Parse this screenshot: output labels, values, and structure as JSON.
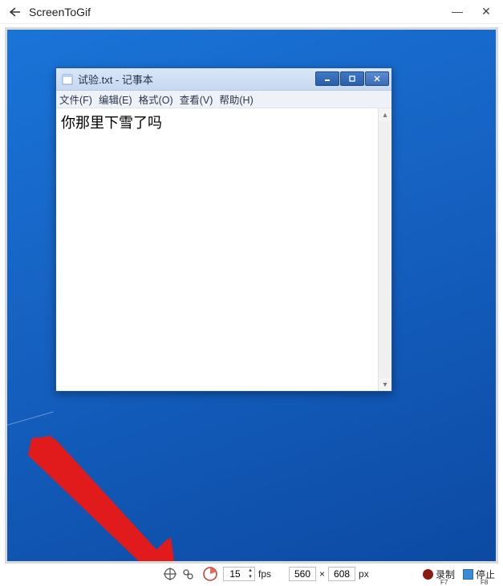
{
  "outer": {
    "title": "ScreenToGif"
  },
  "notepad": {
    "title": "试验.txt - 记事本",
    "menu": {
      "file": "文件(F)",
      "edit": "编辑(E)",
      "format": "格式(O)",
      "view": "查看(V)",
      "help": "帮助(H)"
    },
    "content": "你那里下雪了吗"
  },
  "toolbar": {
    "fps_value": "15",
    "fps_label": "fps",
    "width": "560",
    "height": "608",
    "dim_sep": "×",
    "px_label": "px",
    "record_label": "录制",
    "record_key": "F7",
    "stop_label": "停止",
    "stop_key": "F8"
  }
}
